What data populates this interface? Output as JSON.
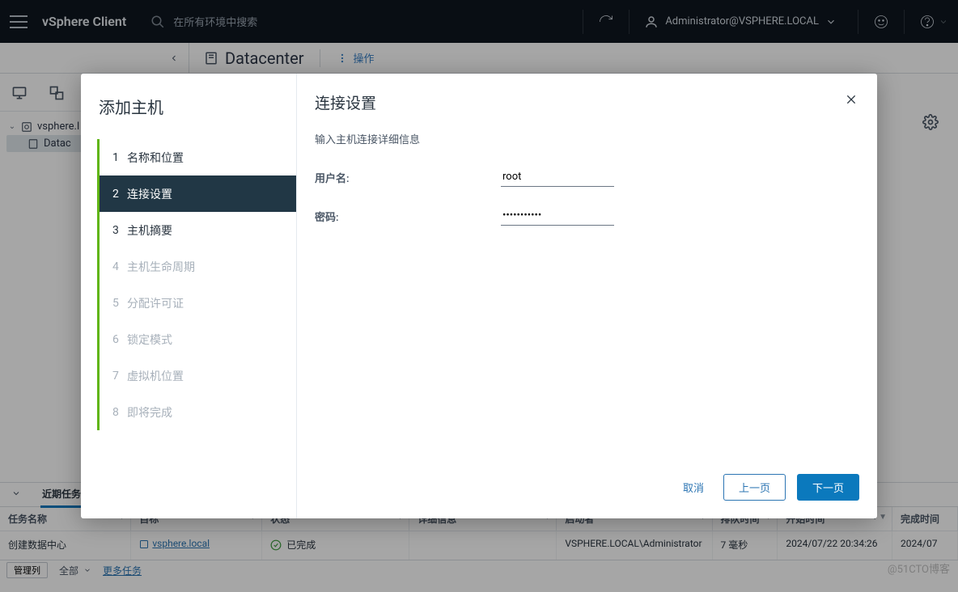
{
  "topbar": {
    "brand": "vSphere Client",
    "search_placeholder": "在所有环境中搜索",
    "user": "Administrator@VSPHERE.LOCAL"
  },
  "subhead": {
    "title": "Datacenter",
    "actions_label": "操作"
  },
  "sidebar": {
    "tree": {
      "root": "vsphere.l",
      "child": "Datac"
    }
  },
  "wizard": {
    "title": "添加主机",
    "steps": [
      {
        "n": "1",
        "label": "名称和位置",
        "state": "done"
      },
      {
        "n": "2",
        "label": "连接设置",
        "state": "active"
      },
      {
        "n": "3",
        "label": "主机摘要",
        "state": "done"
      },
      {
        "n": "4",
        "label": "主机生命周期",
        "state": "disabled"
      },
      {
        "n": "5",
        "label": "分配许可证",
        "state": "disabled"
      },
      {
        "n": "6",
        "label": "锁定模式",
        "state": "disabled"
      },
      {
        "n": "7",
        "label": "虚拟机位置",
        "state": "disabled"
      },
      {
        "n": "8",
        "label": "即将完成",
        "state": "disabled"
      }
    ],
    "panel_title": "连接设置",
    "panel_sub": "输入主机连接详细信息",
    "user_label": "用户名:",
    "user_value": "root",
    "pass_label": "密码:",
    "pass_value": "•••••••••••",
    "cancel": "取消",
    "back": "上一页",
    "next": "下一页"
  },
  "tasks": {
    "tab_recent": "近期任务",
    "columns": {
      "name": "任务名称",
      "target": "目标",
      "status": "状态",
      "details": "详细信息",
      "initiator": "启动者",
      "queued": "排队时间",
      "start": "开始时间",
      "complete": "完成时间"
    },
    "row": {
      "name": "创建数据中心",
      "target": "vsphere.local",
      "status": "已完成",
      "details": "",
      "initiator": "VSPHERE.LOCAL\\Administrator",
      "queued": "7 毫秒",
      "start": "2024/07/22 20:34:26",
      "complete": "2024/07"
    },
    "footer": {
      "manage": "管理列",
      "all": "全部",
      "more": "更多任务"
    }
  },
  "watermark": "@51CTO博客"
}
